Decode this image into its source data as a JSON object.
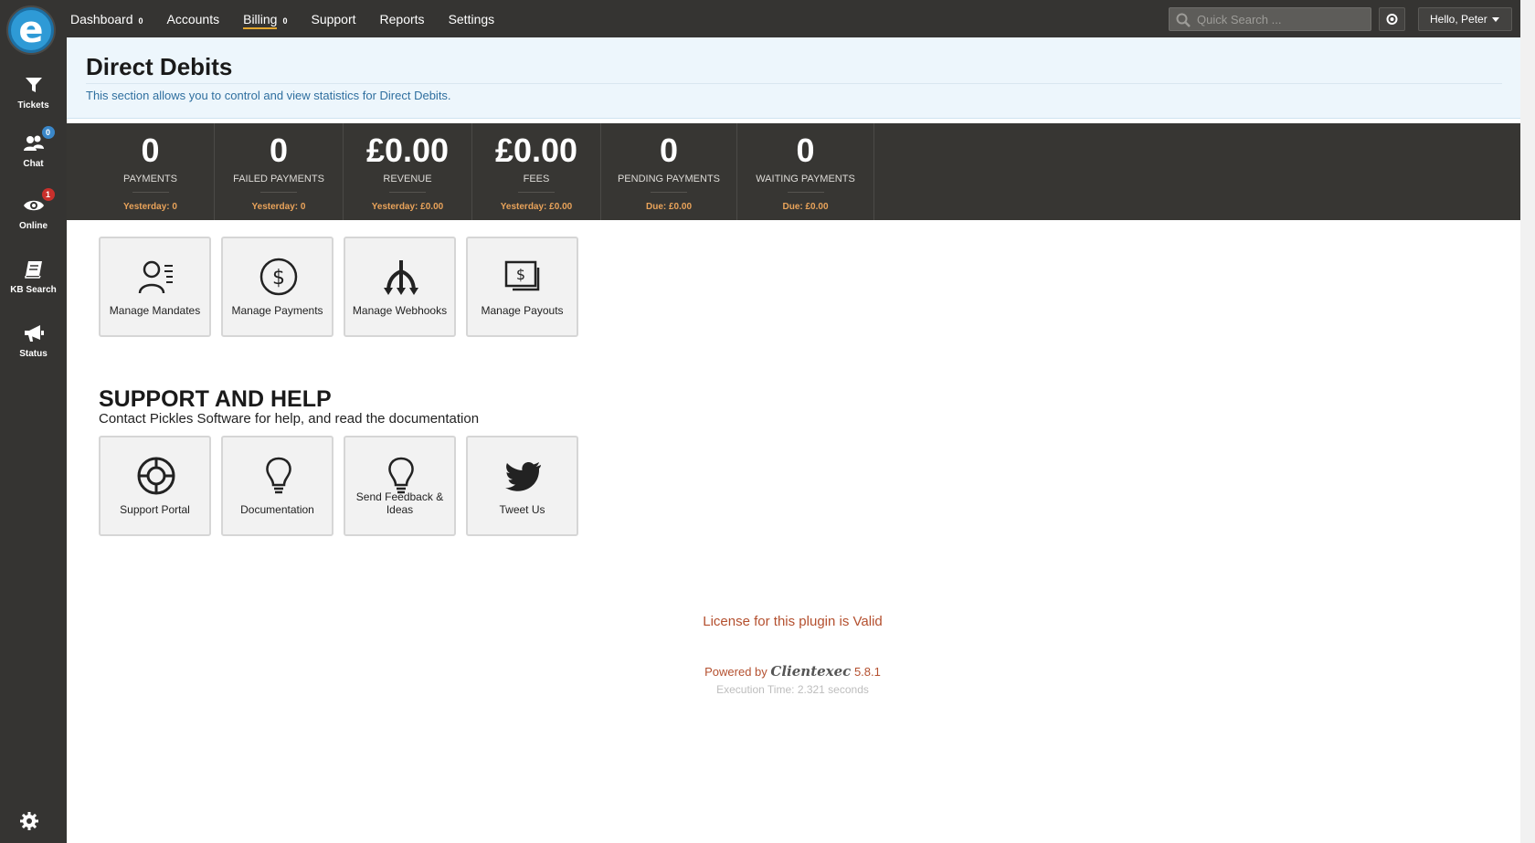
{
  "sidebar": {
    "logo_letter": "e",
    "items": [
      {
        "label": "Tickets",
        "icon": "funnel-icon"
      },
      {
        "label": "Chat",
        "icon": "users-icon",
        "badge": "0"
      },
      {
        "label": "Online",
        "icon": "eye-icon",
        "badge": "1"
      },
      {
        "label": "KB Search",
        "icon": "book-icon"
      },
      {
        "label": "Status",
        "icon": "megaphone-icon"
      }
    ]
  },
  "topbar": {
    "nav": [
      {
        "label": "Dashboard",
        "badge": "0"
      },
      {
        "label": "Accounts"
      },
      {
        "label": "Billing",
        "badge": "0",
        "active": true
      },
      {
        "label": "Support"
      },
      {
        "label": "Reports"
      },
      {
        "label": "Settings"
      }
    ],
    "search_placeholder": "Quick Search ...",
    "user_greeting": "Hello, Peter"
  },
  "header": {
    "title": "Direct Debits",
    "description": "This section allows you to control and view statistics for Direct Debits."
  },
  "stats": [
    {
      "value": "0",
      "label": "PAYMENTS",
      "sub": "Yesterday: 0"
    },
    {
      "value": "0",
      "label": "FAILED PAYMENTS",
      "sub": "Yesterday: 0"
    },
    {
      "value": "£0.00",
      "label": "REVENUE",
      "sub": "Yesterday: £0.00"
    },
    {
      "value": "£0.00",
      "label": "FEES",
      "sub": "Yesterday: £0.00"
    },
    {
      "value": "0",
      "label": "PENDING PAYMENTS",
      "sub": "Due: £0.00"
    },
    {
      "value": "0",
      "label": "WAITING PAYMENTS",
      "sub": "Due: £0.00"
    }
  ],
  "manage_tiles": [
    {
      "label": "Manage Mandates",
      "icon": "mandates-icon"
    },
    {
      "label": "Manage Payments",
      "icon": "dollar-circle-icon"
    },
    {
      "label": "Manage Webhooks",
      "icon": "webhooks-icon"
    },
    {
      "label": "Manage Payouts",
      "icon": "payouts-icon"
    }
  ],
  "support": {
    "title": "SUPPORT AND HELP",
    "subtitle": "Contact Pickles Software for help, and read the documentation",
    "tiles": [
      {
        "label": "Support Portal",
        "icon": "lifebuoy-icon"
      },
      {
        "label": "Documentation",
        "icon": "lightbulb-icon"
      },
      {
        "label": "Send Feedback & Ideas",
        "icon": "lightbulb-icon"
      },
      {
        "label": "Tweet Us",
        "icon": "twitter-bird-icon"
      }
    ]
  },
  "footer": {
    "license": "License for this plugin is Valid",
    "powered_prefix": "Powered by",
    "brand": "Clientexec",
    "version": "5.8.1",
    "execution": "Execution Time: 2.321 seconds"
  }
}
